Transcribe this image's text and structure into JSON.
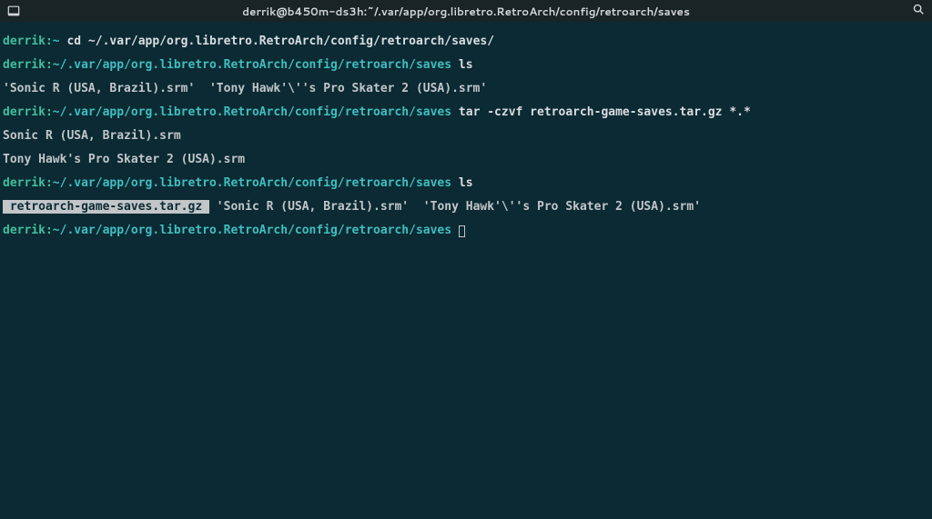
{
  "titlebar": {
    "title": "derrik@b450m-ds3h:~/.var/app/org.libretro.RetroArch/config/retroarch/saves"
  },
  "prompt": {
    "user": "derrik",
    "sep": ":",
    "home_symbol": "~",
    "path_long": "~/.var/app/org.libretro.RetroArch/config/retroarch/saves"
  },
  "lines": {
    "l1_cmd": " cd ~/.var/app/org.libretro.RetroArch/config/retroarch/saves/",
    "l2_cmd": " ls",
    "l3_out": "'Sonic R (USA, Brazil).srm'  'Tony Hawk'\\''s Pro Skater 2 (USA).srm'",
    "l4_cmd": " tar -czvf retroarch-game-saves.tar.gz *.*",
    "l5_out": "Sonic R (USA, Brazil).srm",
    "l6_out": "Tony Hawk's Pro Skater 2 (USA).srm",
    "l7_cmd": " ls",
    "l8_hl": " retroarch-game-saves.tar.gz ",
    "l8_rest": " 'Sonic R (USA, Brazil).srm'  'Tony Hawk'\\''s Pro Skater 2 (USA).srm'",
    "l9_cmd": " "
  }
}
